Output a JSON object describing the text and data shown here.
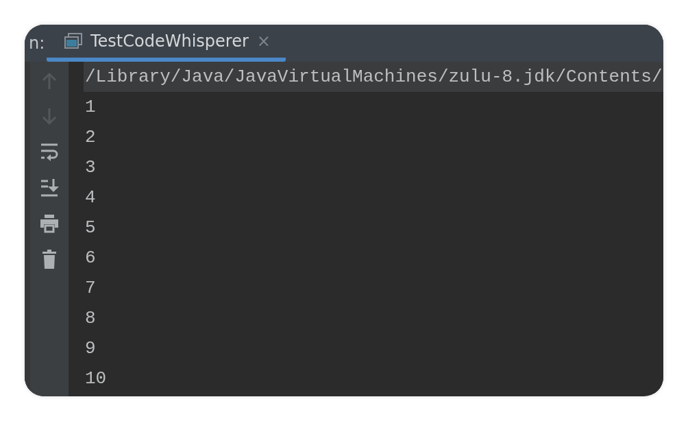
{
  "tab_bar": {
    "prefix": "n:",
    "tabs": [
      {
        "label": "TestCodeWhisperer",
        "close": "×",
        "selected": true
      }
    ]
  },
  "toolbar": [
    {
      "kind": "up",
      "disabled": true
    },
    {
      "kind": "down",
      "disabled": true
    },
    {
      "kind": "wrap",
      "disabled": false
    },
    {
      "kind": "scroll-end",
      "disabled": false
    },
    {
      "kind": "print",
      "disabled": false
    },
    {
      "kind": "trash",
      "disabled": false
    }
  ],
  "console": {
    "lines": [
      {
        "text": "/Library/Java/JavaVirtualMachines/zulu-8.jdk/Contents/",
        "selected": true
      },
      {
        "text": "1",
        "selected": false
      },
      {
        "text": "2",
        "selected": false
      },
      {
        "text": "3",
        "selected": false
      },
      {
        "text": "4",
        "selected": false
      },
      {
        "text": "5",
        "selected": false
      },
      {
        "text": "6",
        "selected": false
      },
      {
        "text": "7",
        "selected": false
      },
      {
        "text": "8",
        "selected": false
      },
      {
        "text": "9",
        "selected": false
      },
      {
        "text": "10",
        "selected": false
      }
    ]
  }
}
